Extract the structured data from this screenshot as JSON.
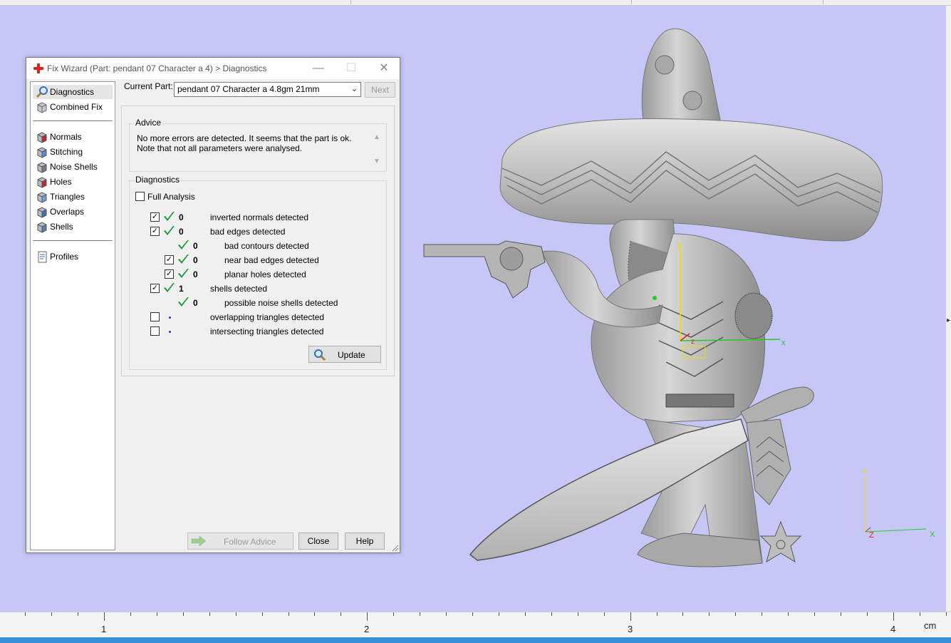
{
  "dialog": {
    "title": "Fix Wizard (Part: pendant 07 Character a 4) > Diagnostics",
    "minimize_glyph": "—",
    "maximize_glyph": "☐",
    "close_glyph": "✕"
  },
  "sidebar": {
    "items": [
      {
        "label": "Diagnostics",
        "icon": "magnifier-icon",
        "selected": true
      },
      {
        "label": "Combined Fix",
        "icon": "combined-fix-icon"
      },
      {
        "label": "Normals",
        "icon": "normals-cube-icon"
      },
      {
        "label": "Stitching",
        "icon": "stitching-cube-icon"
      },
      {
        "label": "Noise Shells",
        "icon": "noise-shells-cube-icon"
      },
      {
        "label": "Holes",
        "icon": "holes-cube-icon"
      },
      {
        "label": "Triangles",
        "icon": "triangles-cube-icon"
      },
      {
        "label": "Overlaps",
        "icon": "overlaps-cube-icon"
      },
      {
        "label": "Shells",
        "icon": "shells-cube-icon"
      },
      {
        "label": "Profiles",
        "icon": "profiles-document-icon"
      }
    ]
  },
  "current_part": {
    "label": "Current Part:",
    "value": "pendant 07 Character a 4.8gm 21mm",
    "next_label": "Next"
  },
  "advice": {
    "title": "Advice",
    "text": "No more errors are detected. It seems that the part is ok. Note that not all parameters were analysed."
  },
  "diagnostics": {
    "title": "Diagnostics",
    "full_analysis_label": "Full Analysis",
    "rows": [
      {
        "checked": true,
        "ok": true,
        "count": "0",
        "label": "inverted normals detected",
        "indent": 0
      },
      {
        "checked": true,
        "ok": true,
        "count": "0",
        "label": "bad edges detected",
        "indent": 0
      },
      {
        "has_checkbox": false,
        "ok": true,
        "count": "0",
        "label": "bad contours detected",
        "indent": 1
      },
      {
        "checked": true,
        "ok": true,
        "count": "0",
        "label": "near bad edges detected",
        "indent": 1
      },
      {
        "checked": true,
        "ok": true,
        "count": "0",
        "label": "planar holes detected",
        "indent": 1
      },
      {
        "checked": true,
        "ok": true,
        "count": "1",
        "label": "shells detected",
        "indent": 0
      },
      {
        "has_checkbox": false,
        "ok": true,
        "count": "0",
        "label": "possible noise shells detected",
        "indent": 1
      },
      {
        "checked": false,
        "ok": false,
        "count": "",
        "label": "overlapping triangles detected",
        "indent": 0
      },
      {
        "checked": false,
        "ok": false,
        "count": "",
        "label": "intersecting triangles detected",
        "indent": 0
      }
    ],
    "update_label": "Update"
  },
  "buttons": {
    "follow_advice": "Follow Advice",
    "close": "Close",
    "help": "Help"
  },
  "ruler": {
    "labels": [
      "1",
      "2",
      "3",
      "4"
    ],
    "unit": "cm"
  },
  "axes": {
    "main_x": "x",
    "main_y": "y",
    "main_z": "z",
    "corner_x": "X",
    "corner_y": "Y",
    "corner_z": "Z"
  },
  "colors": {
    "viewport_bg": "#c7c7f7",
    "model_gray": "#b8b8b8",
    "check_green": "#1f9a3a",
    "status_blue": "#3c8fdb",
    "axis_x": "#22cc22",
    "axis_y": "#e8e000",
    "axis_z": "#e02020"
  }
}
